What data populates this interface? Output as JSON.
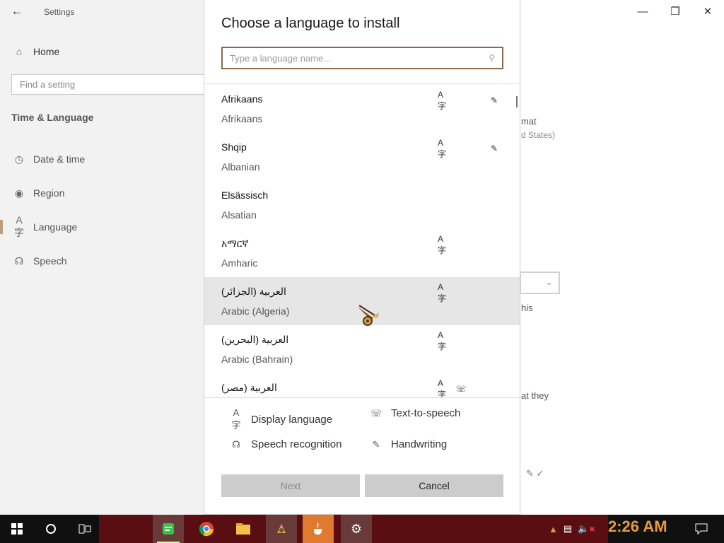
{
  "settings": {
    "app_title": "Settings",
    "home_label": "Home",
    "search_placeholder": "Find a setting",
    "section_title": "Time & Language",
    "nav": [
      {
        "label": "Date & time",
        "icon": "calendar-clock-icon"
      },
      {
        "label": "Region",
        "icon": "globe-icon"
      },
      {
        "label": "Language",
        "icon": "language-icon"
      },
      {
        "label": "Speech",
        "icon": "microphone-icon"
      }
    ],
    "background_fragments": {
      "format": "mat",
      "united_states": "d States)",
      "this": "his",
      "that_they": "at they"
    }
  },
  "dialog": {
    "title": "Choose a language to install",
    "search_placeholder": "Type a language name...",
    "languages": [
      {
        "native": "Afrikaans",
        "english": "Afrikaans",
        "display": true,
        "handwriting": true,
        "tts": false,
        "selected": false
      },
      {
        "native": "Shqip",
        "english": "Albanian",
        "display": true,
        "handwriting": true,
        "tts": false,
        "selected": false
      },
      {
        "native": "Elsässisch",
        "english": "Alsatian",
        "display": false,
        "handwriting": false,
        "tts": false,
        "selected": false
      },
      {
        "native": "አማርኛ",
        "english": "Amharic",
        "display": true,
        "handwriting": false,
        "tts": false,
        "selected": false
      },
      {
        "native": "العربية (الجزائر)",
        "english": "Arabic (Algeria)",
        "display": true,
        "handwriting": false,
        "tts": false,
        "selected": true
      },
      {
        "native": "العربية (البحرين)",
        "english": "Arabic (Bahrain)",
        "display": true,
        "handwriting": false,
        "tts": false,
        "selected": false
      },
      {
        "native": "العربية (مصر)",
        "english": "",
        "display": true,
        "handwriting": false,
        "tts": true,
        "selected": false
      }
    ],
    "legend": {
      "display_language": "Display language",
      "text_to_speech": "Text-to-speech",
      "speech_recognition": "Speech recognition",
      "handwriting": "Handwriting"
    },
    "buttons": {
      "next": "Next",
      "cancel": "Cancel"
    }
  },
  "taskbar": {
    "clock": "2:26 AM",
    "apps": [
      "start-icon",
      "cortana-icon",
      "task-view-icon",
      "notes-app-icon",
      "chrome-icon",
      "file-explorer-icon",
      "game-app-icon",
      "java-app-icon",
      "settings-gear-icon"
    ]
  },
  "colors": {
    "accent": "#8a6a46",
    "selected_row": "#e6e6e6",
    "button_bg": "#cccccc",
    "clock": "#e89a3c",
    "taskbar_active": "#e07a2e"
  }
}
